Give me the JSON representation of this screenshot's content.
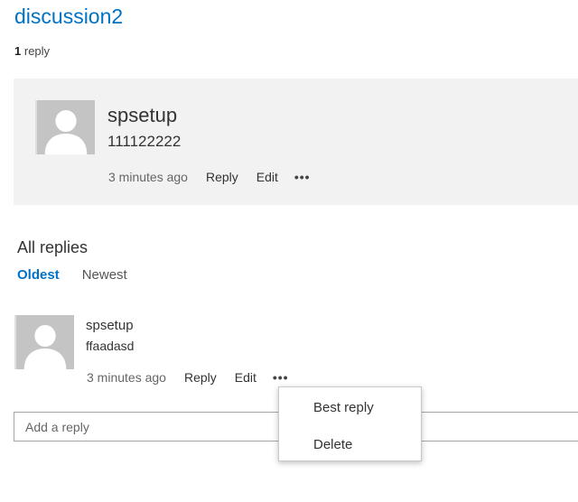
{
  "discussion": {
    "title": "discussion2",
    "reply_count": "1",
    "reply_count_label": "reply"
  },
  "root_post": {
    "author": "spsetup",
    "body": "111122222",
    "time": "3 minutes ago",
    "reply_label": "Reply",
    "edit_label": "Edit",
    "more_label": "•••"
  },
  "replies_section": {
    "title": "All replies",
    "sort_options": {
      "oldest": "Oldest",
      "newest": "Newest"
    },
    "selected_sort": "Oldest"
  },
  "replies": [
    {
      "author": "spsetup",
      "body": "ffaadasd",
      "time": "3 minutes ago",
      "reply_label": "Reply",
      "edit_label": "Edit",
      "more_label": "•••"
    }
  ],
  "add_reply": {
    "placeholder": "Add a reply"
  },
  "context_menu": {
    "items": [
      "Best reply",
      "Delete"
    ]
  },
  "colors": {
    "accent": "#0072c6",
    "post_background": "#f2f2f2",
    "avatar_background": "#c4c4c4"
  },
  "icons": {
    "avatar": "person-placeholder-icon",
    "more": "more-options-icon"
  }
}
